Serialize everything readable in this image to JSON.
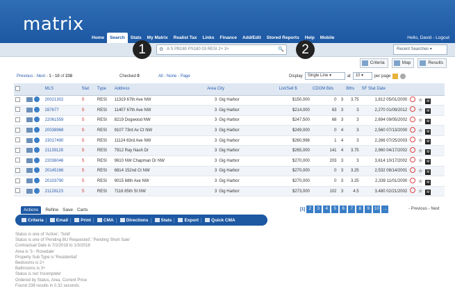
{
  "header": {
    "logo": "matrix",
    "user": "Hello, David - Logout",
    "nav": [
      "Home",
      "Search",
      "Stats",
      "My Matrix",
      "Realist Tax",
      "Links",
      "Finance",
      "Add/Edit",
      "Stored Reports",
      "Help",
      "Mobile"
    ],
    "active_nav": "Search"
  },
  "search": {
    "value": "A S PB180 PS180 03 RESI 2+ 3+",
    "recent": "Recent Searches"
  },
  "callouts": [
    "1",
    "2"
  ],
  "tabs": {
    "criteria": "Criteria",
    "map": "Map",
    "results": "Results"
  },
  "pager": {
    "previous": "Previous",
    "next": "Next",
    "range": "1 - 10",
    "of": "of",
    "total": "238",
    "checked_label": "Checked",
    "checked": "0",
    "all": "All",
    "none": "None",
    "page": "Page",
    "display_label": "Display",
    "display": "Single Line",
    "at_label": "at",
    "per_page": "10",
    "per_page_label": "per page"
  },
  "columns": [
    "MLS",
    "Stat",
    "Type",
    "Address",
    "Area City",
    "List/Sell $",
    "CDOM Bds",
    "Bths",
    "SF Stat Date"
  ],
  "rows": [
    {
      "mls": "20021302",
      "stat": "S",
      "type": "RESI",
      "address": "11319 67th Ave NW",
      "area": "3",
      "city": "Gig Harbor",
      "price": "$150,000",
      "cdom": "0",
      "bds": "3",
      "bths": "3.75",
      "sf": "1,812",
      "date": "05/01/2000"
    },
    {
      "mls": "287677",
      "stat": "S",
      "type": "RESI",
      "address": "11407 67th Ave NW",
      "area": "3",
      "city": "Gig Harbor",
      "price": "$214,000",
      "cdom": "63",
      "bds": "3",
      "bths": "3",
      "sf": "2,270",
      "date": "01/09/2012"
    },
    {
      "mls": "22061559",
      "stat": "S",
      "type": "RESI",
      "address": "8219 Dogwood NW",
      "area": "3",
      "city": "Gig Harbor",
      "price": "$247,500",
      "cdom": "68",
      "bds": "3",
      "bths": "3",
      "sf": "2,694",
      "date": "09/05/2002"
    },
    {
      "mls": "20038968",
      "stat": "S",
      "type": "RESI",
      "address": "9107 73rd Av Ct NW",
      "area": "3",
      "city": "Gig Harbor",
      "price": "$249,000",
      "cdom": "0",
      "bds": "4",
      "bths": "3",
      "sf": "2,560",
      "date": "07/13/2000"
    },
    {
      "mls": "23017490",
      "stat": "S",
      "type": "RESI",
      "address": "11124 63rd Ave NW",
      "area": "3",
      "city": "Gig Harbor",
      "price": "$260,998",
      "cdom": "1",
      "bds": "4",
      "bths": "3",
      "sf": "2,266",
      "date": "07/25/2003"
    },
    {
      "mls": "21139128",
      "stat": "S",
      "type": "RESI",
      "address": "7912 Ray Nash Dr",
      "area": "3",
      "city": "Gig Harbor",
      "price": "$265,000",
      "cdom": "141",
      "bds": "4",
      "bths": "3.75",
      "sf": "2,960",
      "date": "04/17/2002"
    },
    {
      "mls": "22036046",
      "stat": "S",
      "type": "RESI",
      "address": "9610 NW Chapman Dr NW",
      "area": "3",
      "city": "Gig Harbor",
      "price": "$270,000",
      "cdom": "203",
      "bds": "3",
      "bths": "3",
      "sf": "3,614",
      "date": "10/17/2002"
    },
    {
      "mls": "20145166",
      "stat": "S",
      "type": "RESI",
      "address": "6814 152nd Ct NW",
      "area": "3",
      "city": "Gig Harbor",
      "price": "$270,000",
      "cdom": "0",
      "bds": "3",
      "bths": "3.25",
      "sf": "2,532",
      "date": "08/14/2001"
    },
    {
      "mls": "20103790",
      "stat": "S",
      "type": "RESI",
      "address": "9015 68th Ave NW",
      "area": "3",
      "city": "Gig Harbor",
      "price": "$270,000",
      "cdom": "0",
      "bds": "3",
      "bths": "3.25",
      "sf": "2,339",
      "date": "11/01/2000"
    },
    {
      "mls": "21128123",
      "stat": "S",
      "type": "RESI",
      "address": "7116 85th St NW",
      "area": "3",
      "city": "Gig Harbor",
      "price": "$273,000",
      "cdom": "102",
      "bds": "3",
      "bths": "4.5",
      "sf": "3,480",
      "date": "02/21/2002"
    }
  ],
  "actions": {
    "tabs": [
      "Actions",
      "Refine",
      "Save",
      "Carts"
    ],
    "buttons": [
      "Criteria",
      "Email",
      "Print",
      "CMA",
      "Directions",
      "Stats",
      "Export",
      "Quick CMA"
    ]
  },
  "pagination": {
    "current": "[1]",
    "pages": [
      "2",
      "3",
      "4",
      "5",
      "6",
      "7",
      "8",
      "9",
      "10",
      "..."
    ],
    "prev_next": "- Previous - Next"
  },
  "summary": [
    "Status is one of 'Active', 'Sold'",
    "Status is one of 'Pending BU Requested', 'Pending Short Sale'",
    "Contractual Date is 7/2/2018 to 1/3/2018",
    "Area is '3 - Rosedale'",
    "Property Sub Type is 'Residential'",
    "Bedrooms is 2+",
    "Bathrooms is 3+",
    "Status is not 'Incomplete'",
    "Ordered by Status, Area, Current Price",
    "Found 238 results in 0.32 seconds."
  ]
}
